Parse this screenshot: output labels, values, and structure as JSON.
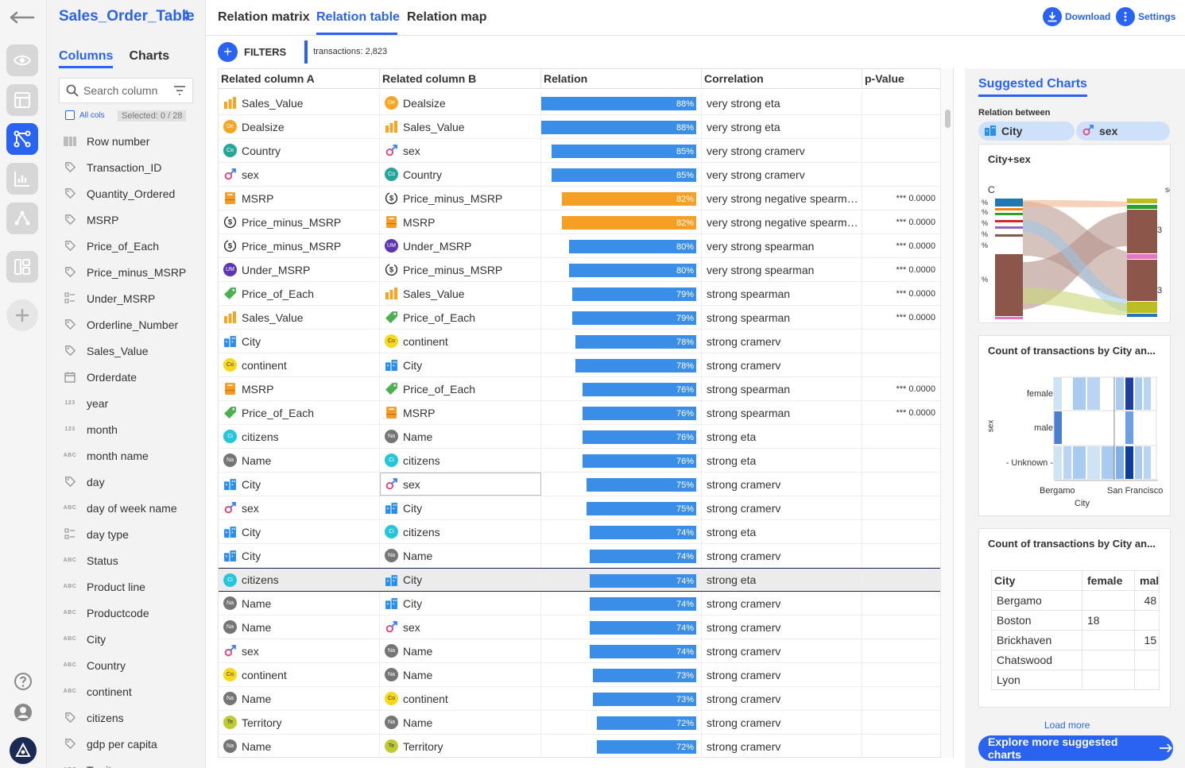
{
  "dataset": {
    "name": "Sales_Order_Table"
  },
  "column_panel": {
    "tabs": [
      "Columns",
      "Charts"
    ],
    "active_tab": "Columns",
    "search_placeholder": "Search column",
    "all_cols_label": "All cols",
    "selected_label": "Selected: 0 / 28",
    "columns": [
      {
        "name": "Row number",
        "icon": "barcode-icon",
        "type_label": ""
      },
      {
        "name": "Transaction_ID",
        "icon": "tag-icon",
        "type_label": ""
      },
      {
        "name": "Quantity_Ordered",
        "icon": "tag-icon",
        "type_label": ""
      },
      {
        "name": "MSRP",
        "icon": "tag-icon",
        "type_label": ""
      },
      {
        "name": "Price_of_Each",
        "icon": "tag-icon",
        "type_label": ""
      },
      {
        "name": "Price_minus_MSRP",
        "icon": "tag-icon",
        "type_label": ""
      },
      {
        "name": "Under_MSRP",
        "icon": "boolean-icon",
        "type_label": ""
      },
      {
        "name": "Orderline_Number",
        "icon": "tag-icon",
        "type_label": ""
      },
      {
        "name": "Sales_Value",
        "icon": "tag-icon",
        "type_label": ""
      },
      {
        "name": "Orderdate",
        "icon": "calendar-icon",
        "type_label": ""
      },
      {
        "name": "year",
        "icon": "numeric-icon",
        "type_label": "123"
      },
      {
        "name": "month",
        "icon": "numeric-icon",
        "type_label": "123"
      },
      {
        "name": "month name",
        "icon": "text-icon",
        "type_label": "ABC"
      },
      {
        "name": "day",
        "icon": "tag-icon",
        "type_label": ""
      },
      {
        "name": "day of week name",
        "icon": "text-icon",
        "type_label": "ABC"
      },
      {
        "name": "day type",
        "icon": "boolean-icon",
        "type_label": ""
      },
      {
        "name": "Status",
        "icon": "text-icon",
        "type_label": "ABC"
      },
      {
        "name": "Product line",
        "icon": "text-icon",
        "type_label": "ABC"
      },
      {
        "name": "Productcode",
        "icon": "text-icon",
        "type_label": "ABC"
      },
      {
        "name": "City",
        "icon": "text-icon",
        "type_label": "ABC"
      },
      {
        "name": "Country",
        "icon": "text-icon",
        "type_label": "ABC"
      },
      {
        "name": "continent",
        "icon": "text-icon",
        "type_label": "ABC"
      },
      {
        "name": "citizens",
        "icon": "tag-icon",
        "type_label": ""
      },
      {
        "name": "gdp per capita",
        "icon": "tag-icon",
        "type_label": ""
      },
      {
        "name": "Territory",
        "icon": "text-icon",
        "type_label": "ABC"
      }
    ]
  },
  "tabs": {
    "items": [
      "Relation matrix",
      "Relation table",
      "Relation map"
    ],
    "active": "Relation table",
    "download_label": "Download",
    "settings_label": "Settings"
  },
  "filters": {
    "label": "FILTERS",
    "transactions_label": "transactions: 2,823"
  },
  "table": {
    "headers": [
      "Related column A",
      "Related column B",
      "Relation",
      "Correlation",
      "p-Value"
    ],
    "rows": [
      {
        "a": "Sales_Value",
        "ai": "bar-chart-icon",
        "b": "Dealsize",
        "bi": "De",
        "rel": 88,
        "rel_label": "88%",
        "corr": "very strong eta",
        "p": "",
        "neg": false
      },
      {
        "a": "Dealsize",
        "ai": "De",
        "b": "Sales_Value",
        "bi": "bar-chart-icon",
        "rel": 88,
        "rel_label": "88%",
        "corr": "very strong eta",
        "p": "",
        "neg": false
      },
      {
        "a": "Country",
        "ai": "Co",
        "b": "sex",
        "bi": "gender-icon",
        "rel": 85,
        "rel_label": "85%",
        "corr": "very strong cramerv",
        "p": "",
        "neg": false
      },
      {
        "a": "sex",
        "ai": "gender-icon",
        "b": "Country",
        "bi": "Co",
        "rel": 85,
        "rel_label": "85%",
        "corr": "very strong cramerv",
        "p": "",
        "neg": false
      },
      {
        "a": "MSRP",
        "ai": "msrp-icon",
        "b": "Price_minus_MSRP",
        "bi": "price-minus-icon",
        "rel": 82,
        "rel_label": "82%",
        "corr": "very strong negative spearm…",
        "p": "*** 0.0000",
        "neg": true
      },
      {
        "a": "Price_minus_MSRP",
        "ai": "price-minus-icon",
        "b": "MSRP",
        "bi": "msrp-icon",
        "rel": 82,
        "rel_label": "82%",
        "corr": "very strong negative spearm…",
        "p": "*** 0.0000",
        "neg": true
      },
      {
        "a": "Price_minus_MSRP",
        "ai": "price-minus-icon",
        "b": "Under_MSRP",
        "bi": "UM",
        "rel": 80,
        "rel_label": "80%",
        "corr": "very strong spearman",
        "p": "*** 0.0000",
        "neg": false
      },
      {
        "a": "Under_MSRP",
        "ai": "UM",
        "b": "Price_minus_MSRP",
        "bi": "price-minus-icon",
        "rel": 80,
        "rel_label": "80%",
        "corr": "very strong spearman",
        "p": "*** 0.0000",
        "neg": false
      },
      {
        "a": "Price_of_Each",
        "ai": "price-tag-icon",
        "b": "Sales_Value",
        "bi": "bar-chart-icon",
        "rel": 79,
        "rel_label": "79%",
        "corr": "strong spearman",
        "p": "*** 0.0000",
        "neg": false
      },
      {
        "a": "Sales_Value",
        "ai": "bar-chart-icon",
        "b": "Price_of_Each",
        "bi": "price-tag-icon",
        "rel": 79,
        "rel_label": "79%",
        "corr": "strong spearman",
        "p": "*** 0.0000",
        "neg": false
      },
      {
        "a": "City",
        "ai": "city-icon",
        "b": "continent",
        "bi": "Co",
        "rel": 78,
        "rel_label": "78%",
        "corr": "strong cramerv",
        "p": "",
        "neg": false
      },
      {
        "a": "continent",
        "ai": "Co",
        "b": "City",
        "bi": "city-icon",
        "rel": 78,
        "rel_label": "78%",
        "corr": "strong cramerv",
        "p": "",
        "neg": false
      },
      {
        "a": "MSRP",
        "ai": "msrp-icon",
        "b": "Price_of_Each",
        "bi": "price-tag-icon",
        "rel": 76,
        "rel_label": "76%",
        "corr": "strong spearman",
        "p": "*** 0.0000",
        "neg": false
      },
      {
        "a": "Price_of_Each",
        "ai": "price-tag-icon",
        "b": "MSRP",
        "bi": "msrp-icon",
        "rel": 76,
        "rel_label": "76%",
        "corr": "strong spearman",
        "p": "*** 0.0000",
        "neg": false
      },
      {
        "a": "citizens",
        "ai": "Ci",
        "b": "Name",
        "bi": "Na",
        "rel": 76,
        "rel_label": "76%",
        "corr": "strong eta",
        "p": "",
        "neg": false
      },
      {
        "a": "Name",
        "ai": "Na",
        "b": "citizens",
        "bi": "Ci",
        "rel": 76,
        "rel_label": "76%",
        "corr": "strong eta",
        "p": "",
        "neg": false
      },
      {
        "a": "City",
        "ai": "city-icon",
        "b": "sex",
        "bi": "gender-icon",
        "rel": 75,
        "rel_label": "75%",
        "corr": "strong cramerv",
        "p": "",
        "neg": false,
        "focus_b": true
      },
      {
        "a": "sex",
        "ai": "gender-icon",
        "b": "City",
        "bi": "city-icon",
        "rel": 75,
        "rel_label": "75%",
        "corr": "strong cramerv",
        "p": "",
        "neg": false
      },
      {
        "a": "City",
        "ai": "city-icon",
        "b": "citizens",
        "bi": "Ci",
        "rel": 74,
        "rel_label": "74%",
        "corr": "strong eta",
        "p": "",
        "neg": false
      },
      {
        "a": "City",
        "ai": "city-icon",
        "b": "Name",
        "bi": "Na",
        "rel": 74,
        "rel_label": "74%",
        "corr": "strong cramerv",
        "p": "",
        "neg": false
      },
      {
        "a": "citizens",
        "ai": "Ci",
        "b": "City",
        "bi": "city-icon",
        "rel": 74,
        "rel_label": "74%",
        "corr": "strong eta",
        "p": "",
        "neg": false,
        "selected": true
      },
      {
        "a": "Name",
        "ai": "Na",
        "b": "City",
        "bi": "city-icon",
        "rel": 74,
        "rel_label": "74%",
        "corr": "strong cramerv",
        "p": "",
        "neg": false
      },
      {
        "a": "Name",
        "ai": "Na",
        "b": "sex",
        "bi": "gender-icon",
        "rel": 74,
        "rel_label": "74%",
        "corr": "strong cramerv",
        "p": "",
        "neg": false
      },
      {
        "a": "sex",
        "ai": "gender-icon",
        "b": "Name",
        "bi": "Na",
        "rel": 74,
        "rel_label": "74%",
        "corr": "strong cramerv",
        "p": "",
        "neg": false
      },
      {
        "a": "continent",
        "ai": "Co",
        "b": "Name",
        "bi": "Na",
        "rel": 73,
        "rel_label": "73%",
        "corr": "strong cramerv",
        "p": "",
        "neg": false
      },
      {
        "a": "Name",
        "ai": "Na",
        "b": "continent",
        "bi": "Co",
        "rel": 73,
        "rel_label": "73%",
        "corr": "strong cramerv",
        "p": "",
        "neg": false
      },
      {
        "a": "Territory",
        "ai": "Te",
        "b": "Name",
        "bi": "Na",
        "rel": 72,
        "rel_label": "72%",
        "corr": "strong cramerv",
        "p": "",
        "neg": false
      },
      {
        "a": "Name",
        "ai": "Na",
        "b": "Territory",
        "bi": "Te",
        "rel": 72,
        "rel_label": "72%",
        "corr": "strong cramerv",
        "p": "",
        "neg": false
      }
    ]
  },
  "suggested": {
    "title": "Suggested Charts",
    "relation_between_label": "Relation between",
    "chips": [
      {
        "label": "City",
        "icon": "city-icon"
      },
      {
        "label": "sex",
        "icon": "gender-icon"
      }
    ],
    "cards": [
      {
        "title": "City+sex",
        "sankey_left_label": "C",
        "sankey_right_label": "se",
        "left_pct_labels": [
          "%",
          "%",
          "%",
          "%",
          "%",
          "%"
        ],
        "right_labels": [
          "3",
          "3"
        ]
      },
      {
        "title": "Count of transactions by City an...",
        "y_axis_label": "sex",
        "y_ticks": [
          "female",
          "male",
          "- Unknown -"
        ],
        "x_ticks": [
          "Bergamo",
          "San Francisco"
        ],
        "x_axis_label": "City"
      },
      {
        "title": "Count of transactions by City an...",
        "columns": [
          "City",
          "female",
          "mal"
        ],
        "rows": [
          [
            "Bergamo",
            "",
            "48"
          ],
          [
            "Boston",
            "18",
            ""
          ],
          [
            "Brickhaven",
            "",
            "15"
          ],
          [
            "Chatswood",
            "",
            ""
          ],
          [
            "Lyon",
            "",
            ""
          ]
        ]
      }
    ],
    "load_more_label": "Load more",
    "explore_label": "Explore more suggested charts"
  },
  "colors": {
    "accent": "#2a63f2",
    "bar_positive": "#3b8ee8",
    "bar_negative": "#f5a024"
  }
}
